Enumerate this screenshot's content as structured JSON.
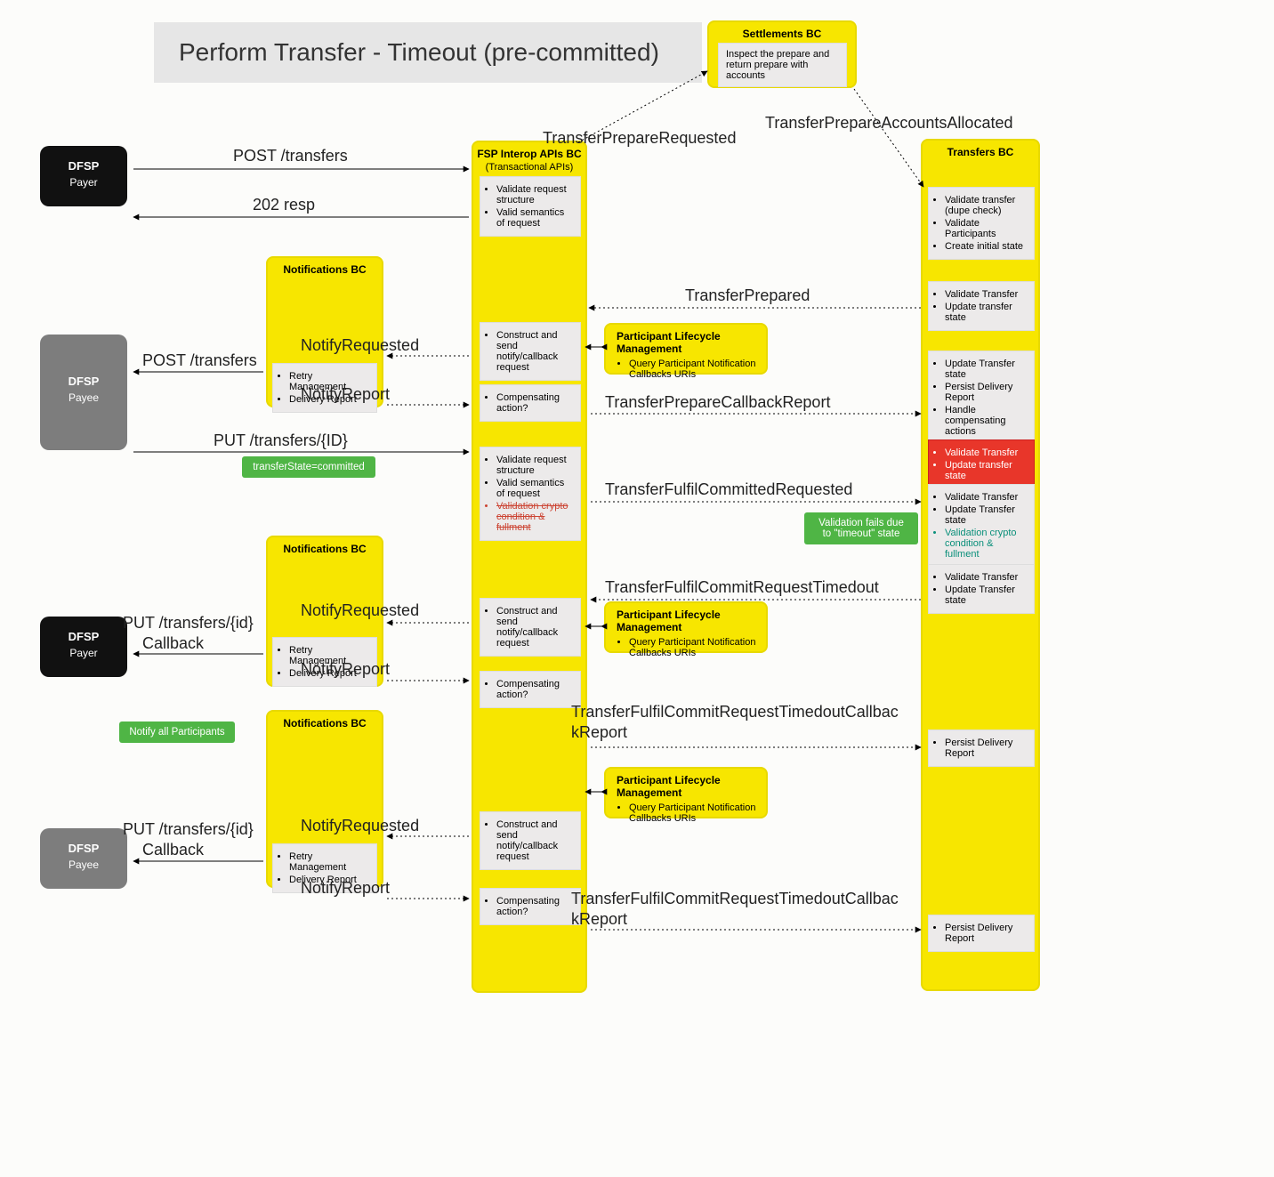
{
  "title": "Perform Transfer - Timeout (pre-committed)",
  "dfsp": {
    "label": "DFSP",
    "payer": "Payer",
    "payee": "Payee"
  },
  "settlements": {
    "title": "Settlements BC",
    "body": "Inspect the prepare and return prepare with accounts"
  },
  "fsp": {
    "title": "FSP Interop APIs BC",
    "sub": "(Transactional APIs)",
    "validate1": [
      "Validate request structure",
      "Valid semantics of request"
    ],
    "construct": [
      "Construct and send notify/callback request"
    ],
    "comp": [
      "Compensating action?"
    ],
    "validate2": [
      "Validate request structure",
      "Valid semantics of request",
      "Validation crypto condition & fullment"
    ]
  },
  "transfers": {
    "title": "Transfers BC",
    "b1": [
      "Validate transfer (dupe check)",
      "Validate Participants",
      "Create initial state"
    ],
    "b2": [
      "Validate Transfer",
      "Update transfer state"
    ],
    "b3": [
      "Update Transfer state",
      "Persist Delivery Report",
      "Handle compensating actions"
    ],
    "bRed": [
      "Validate Transfer",
      "Update transfer state"
    ],
    "b4": [
      "Validate Transfer",
      "Update Transfer state",
      "Validation crypto condition & fullment"
    ],
    "b5": [
      "Validate Transfer",
      "Update Transfer state"
    ],
    "bPersist": [
      "Persist Delivery Report"
    ]
  },
  "plm": {
    "title": "Participant Lifecycle Management",
    "items": [
      "Query Participant Notification Callbacks URIs"
    ]
  },
  "notif": {
    "title": "Notifications BC",
    "items": [
      "Retry Management",
      "Delivery Report"
    ]
  },
  "green": {
    "committed": "transferState=committed",
    "timeout": "Validation fails due to \"timeout\" state",
    "notifyAll": "Notify all Participants"
  },
  "labels": {
    "postTransfers": "POST /transfers",
    "resp202": "202 resp",
    "tpReq": "TransferPrepareRequested",
    "tpaAlloc": "TransferPrepareAccountsAllocated",
    "tPrepared": "TransferPrepared",
    "notifyReq": "NotifyRequested",
    "notifyRep": "NotifyReport",
    "putTransfersId": "PUT /transfers/{ID}",
    "tpCallback": "TransferPrepareCallbackReport",
    "tfcReq": "TransferFulfilCommittedRequested",
    "tfcTimeout": "TransferFulfilCommitRequestTimedout",
    "putTransfersIdLower": "PUT /transfers/{id}",
    "callback": "Callback",
    "tfcTimeoutCb1": "TransferFulfilCommitRequestTimedoutCallbac",
    "tfcTimeoutCb2": "kReport"
  }
}
